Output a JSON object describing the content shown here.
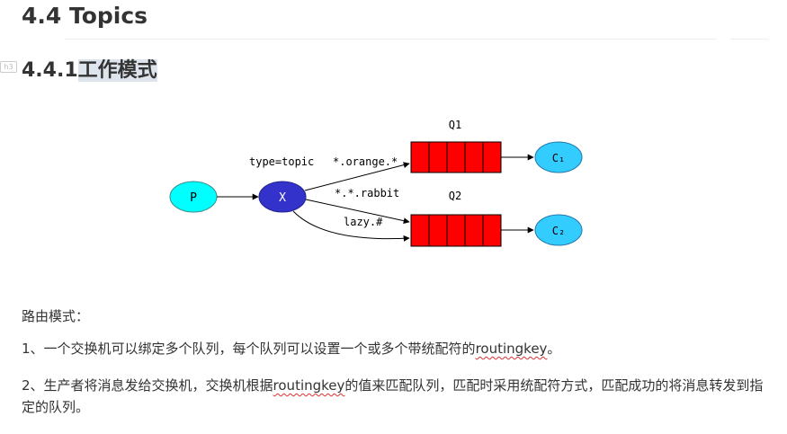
{
  "heading_h2": "4.4 Topics",
  "heading_h3": {
    "number": "4.4.1",
    "title": "工作模式",
    "marker": "h3"
  },
  "diagram": {
    "producer": "P",
    "exchange": "X",
    "exchange_label": "type=topic",
    "bindings": [
      "*.orange.*",
      "*.*.rabbit",
      "lazy.#"
    ],
    "queues": [
      "Q1",
      "Q2"
    ],
    "consumers": [
      "C₁",
      "C₂"
    ],
    "colors": {
      "producer": "#00ffff",
      "exchange": "#3333cc",
      "queue": "#ff0000",
      "consumer": "#33ccff"
    }
  },
  "paragraphs": {
    "p1": "路由模式：",
    "p2_before": "1、一个交换机可以绑定多个队列，每个队列可以设置一个或多个带统配符的",
    "p2_link": "routingkey",
    "p2_after": "。",
    "p3_before": "2、生产者将消息发给交换机，交换机根据",
    "p3_link": "routingkey",
    "p3_after": "的值来匹配队列，匹配时采用统配符方式，匹配成功的将消息转发到指定的队列。"
  }
}
